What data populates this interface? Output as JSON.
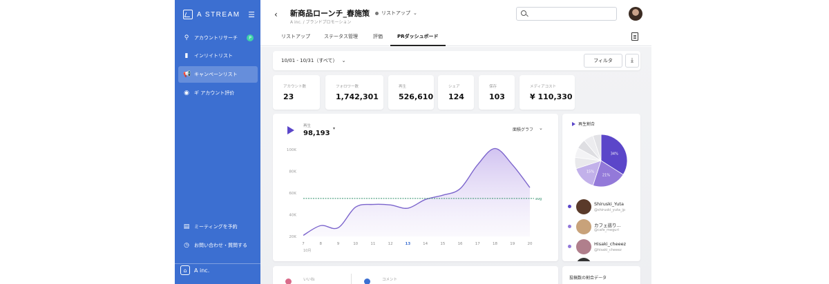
{
  "brand": {
    "name": "A STREAM"
  },
  "sidebar": {
    "items": [
      {
        "label": "アカウントリサーチ",
        "icon": "search-icon",
        "badge": "P"
      },
      {
        "label": "インリイトリスト",
        "icon": "bookmark-icon"
      },
      {
        "label": "キャンペーンリスト",
        "icon": "megaphone-icon"
      },
      {
        "label": "ギ アカウント評价",
        "icon": "location-icon"
      },
      {
        "label": "ミーティングを予約",
        "icon": "calendar-icon"
      },
      {
        "label": "お問い合わせ・質問する",
        "icon": "clock-icon"
      }
    ],
    "org": "A inc."
  },
  "header": {
    "title": "新商品ローンチ_春施策",
    "subtitle": "A inc. / ブランドプロモーション",
    "status": "リストアップ",
    "search_placeholder": ""
  },
  "tabs": [
    {
      "label": "リストアップ"
    },
    {
      "label": "ステータス管理"
    },
    {
      "label": "評価"
    },
    {
      "label": "PRダッシュボード",
      "active": true
    }
  ],
  "filter": {
    "date_range": "10/01 - 10/31（すべて）",
    "filter_label": "フィルタ"
  },
  "kpis": [
    {
      "label": "アカウント数",
      "value": "23"
    },
    {
      "label": "フォロワー数",
      "value": "1,742,301"
    },
    {
      "label": "再生",
      "value": "526,610"
    },
    {
      "label": "シェア",
      "value": "124"
    },
    {
      "label": "保存",
      "value": "103"
    },
    {
      "label": "メディアコスト",
      "value": "¥ 110,330"
    }
  ],
  "chart_card": {
    "metric_label": "再生",
    "metric_value": "98,193",
    "chart_type_label": "面積グラフ"
  },
  "chart_data": {
    "type": "area",
    "x": [
      "7",
      "8",
      "9",
      "10",
      "11",
      "12",
      "13",
      "14",
      "15",
      "16",
      "17",
      "18",
      "19",
      "20"
    ],
    "x_sublabel": "10月",
    "highlight_x": "13",
    "values": [
      21,
      30,
      28,
      47,
      49.5,
      49,
      46,
      54,
      58,
      64,
      86,
      101,
      86,
      65
    ],
    "yticks": [
      20,
      40,
      60,
      80,
      100
    ],
    "ytick_labels": [
      "20K",
      "40K",
      "60K",
      "80K",
      "100K"
    ],
    "ylim": [
      20,
      100
    ],
    "avg_value": 55,
    "avg_label": "avg",
    "colors": {
      "line": "#7b64cc",
      "fill": "#ece6f8",
      "avg": "#2f8f6a"
    }
  },
  "pie_card": {
    "title": "再生割合",
    "slices": [
      {
        "label": "34%",
        "value": 34,
        "color": "#5b46c9"
      },
      {
        "label": "21%",
        "value": 21,
        "color": "#9379d9"
      },
      {
        "label": "15%",
        "value": 15,
        "color": "#c2b1ea"
      },
      {
        "label": "",
        "value": 7,
        "color": "#e9e9ec"
      },
      {
        "label": "",
        "value": 6,
        "color": "#f3f3f5"
      },
      {
        "label": "",
        "value": 6,
        "color": "#dedee2"
      },
      {
        "label": "",
        "value": 6,
        "color": "#ececef"
      },
      {
        "label": "",
        "value": 5,
        "color": "#e2e2e6"
      }
    ],
    "accounts": [
      {
        "name": "Shiruski_Yuta",
        "handle": "@shiruski_yuta_jp",
        "dot": "#5b46c9",
        "avatar": "#5a3a2a"
      },
      {
        "name": "カフェ巡り...",
        "handle": "@cafe_meguri",
        "dot": "#9379d9",
        "avatar": "#c8a27a"
      },
      {
        "name": "Hisaki_cheeez",
        "handle": "@hisaki_cheeez",
        "dot": "#9379d9",
        "avatar": "#b07f8c"
      },
      {
        "name": "",
        "handle": "",
        "dot": "#444444",
        "avatar": "#333333"
      }
    ]
  },
  "bottom": {
    "left_label1": "いいね",
    "left_label2": "コメント",
    "right_title": "投稿数の割合データ"
  }
}
